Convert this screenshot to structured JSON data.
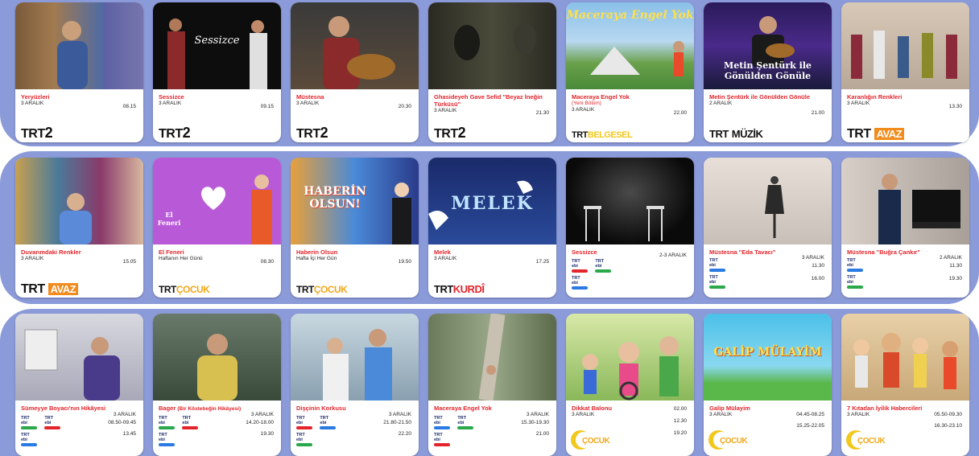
{
  "rows": [
    [
      {
        "title": "Yeryüzleri",
        "date": "3 ARALIK",
        "time": "08.15",
        "logo": {
          "a": "TRT",
          "b": "2"
        }
      },
      {
        "title": "Sessizce",
        "date": "3 ARALIK",
        "time": "09.15",
        "logo": {
          "a": "TRT",
          "b": "2"
        },
        "caption": "Sessizce"
      },
      {
        "title": "Müstesna",
        "date": "3 ARALIK",
        "time": "20.30",
        "logo": {
          "a": "TRT",
          "b": "2"
        }
      },
      {
        "title": "Ghasideyeh Gave Sefid \"Beyaz İneğin Türküsü\"",
        "date": "3 ARALIK",
        "time": "21.30",
        "logo": {
          "a": "TRT",
          "b": "2"
        }
      },
      {
        "title": "Maceraya Engel Yok",
        "subtitle": "(Yeni Bölüm)",
        "date": "3 ARALIK",
        "time": "22.00",
        "logo": {
          "a": "TRT",
          "b": "BELGESEL"
        },
        "caption": "Maceraya Engel Yok"
      },
      {
        "title": "Metin Şentürk ile Gönülden Gönüle",
        "date": "2 ARALIK",
        "time": "21.00",
        "logo": {
          "a": "TRT",
          "b": "MÜZİK"
        },
        "caption": "Metin Şentürk ile Gönülden Gönüle"
      },
      {
        "title": "Karanlığın Renkleri",
        "date": "3 ARALIK",
        "time": "13.30",
        "logo": {
          "a": "TRT",
          "b": "AVAZ"
        }
      }
    ],
    [
      {
        "title": "Duvarımdaki Renkler",
        "date": "3 ARALIK",
        "time": "15.05",
        "logo": {
          "a": "TRT",
          "b": "AVAZ"
        }
      },
      {
        "title": "El Feneri",
        "date": "Haftanın Her Günü",
        "time": "08.30",
        "logo": {
          "a": "TRT",
          "b": "ÇOCUK"
        },
        "caption": "El Feneri"
      },
      {
        "title": "Haberin Olsun",
        "date": "Hafta İçi Her Gün",
        "time": "19.50",
        "logo": {
          "a": "TRT",
          "b": "ÇOCUK"
        },
        "caption": "HABERİN OLSUN!"
      },
      {
        "title": "Melek",
        "date": "3 ARALIK",
        "time": "17.25",
        "logo": {
          "a": "TRT",
          "b": "KURDÎ"
        },
        "caption": "MELEK"
      },
      {
        "title": "Sessizce",
        "date": "2-3 ARALIK",
        "ceps": [
          {
            "n": "TRT ebi",
            "c": "#e3252b"
          },
          {
            "n": "TRT ebi",
            "c": "#2aa84a"
          },
          {
            "n": "TRT ebi",
            "c": "#2a7ae3"
          }
        ]
      },
      {
        "title": "Müstesna \"Eda Tavacı\"",
        "date": "3 ARALIK",
        "times": [
          "11.30",
          "16.00"
        ],
        "ceps": [
          {
            "n": "TRT ebi",
            "c": "#2a7ae3"
          },
          {
            "n": "TRT ebi",
            "c": "#2aa84a"
          }
        ]
      },
      {
        "title": "Müstesna \"Buğra Çankır\"",
        "date": "2 ARALIK",
        "times": [
          "11.30",
          "19.30"
        ],
        "ceps": [
          {
            "n": "TRT ebi",
            "c": "#2a7ae3"
          },
          {
            "n": "TRT ebi",
            "c": "#2aa84a"
          }
        ]
      }
    ],
    [
      {
        "title": "Sümeyye Boyacı'nın Hikâyesi",
        "date": "3 ARALIK",
        "times": [
          "08.50-09.45",
          "13.45"
        ],
        "ceps": [
          {
            "n": "TRT ebi",
            "c": "#2aa84a"
          },
          {
            "n": "TRT ebi",
            "c": "#e3252b"
          },
          {
            "n": "TRT ebi",
            "c": "#2a7ae3"
          }
        ]
      },
      {
        "title": "Bager",
        "subtitle": "(Bir Köstebeğin Hikâyesi)",
        "date": "3 ARALIK",
        "times": [
          "14.20-18.00",
          "19.30"
        ],
        "ceps": [
          {
            "n": "TRT ebi",
            "c": "#2aa84a"
          },
          {
            "n": "TRT ebi",
            "c": "#e3252b"
          },
          {
            "n": "TRT ebi",
            "c": "#2a7ae3"
          }
        ]
      },
      {
        "title": "Dişçinin Korkusu",
        "date": "3 ARALIK",
        "times": [
          "21.80-21.50",
          "22.20"
        ],
        "ceps": [
          {
            "n": "TRT ebi",
            "c": "#e3252b"
          },
          {
            "n": "TRT ebi",
            "c": "#2a7ae3"
          },
          {
            "n": "TRT ebi",
            "c": "#2aa84a"
          }
        ]
      },
      {
        "title": "Maceraya Engel Yok",
        "date": "3 ARALIK",
        "times": [
          "15.30-19.30",
          "21.00"
        ],
        "ceps": [
          {
            "n": "TRT ebi",
            "c": "#2a7ae3"
          },
          {
            "n": "TRT ebi",
            "c": "#2aa84a"
          },
          {
            "n": "TRT ebi",
            "c": "#e3252b"
          }
        ]
      },
      {
        "title": "Dikkat Balonu",
        "date": "3 ARALIK",
        "times": [
          "02.00",
          "12.30",
          "19.20"
        ],
        "logo": {
          "b": "ÇOCUK"
        }
      },
      {
        "title": "Galip Mülayim",
        "date": "3 ARALIK",
        "times": [
          "04.45-08.25",
          "15.25-22.05"
        ],
        "logo": {
          "b": "ÇOCUK"
        },
        "caption": "GALİP MÜLAYİM"
      },
      {
        "title": "7 Kıtadan İyilik Habercileri",
        "date": "3 ARALIK",
        "times": [
          "05.50-09.30",
          "16.30-23.10"
        ],
        "logo": {
          "b": "ÇOCUK"
        }
      }
    ]
  ],
  "colors": {
    "band": "#8b9ad8",
    "title": "#e3252b"
  }
}
